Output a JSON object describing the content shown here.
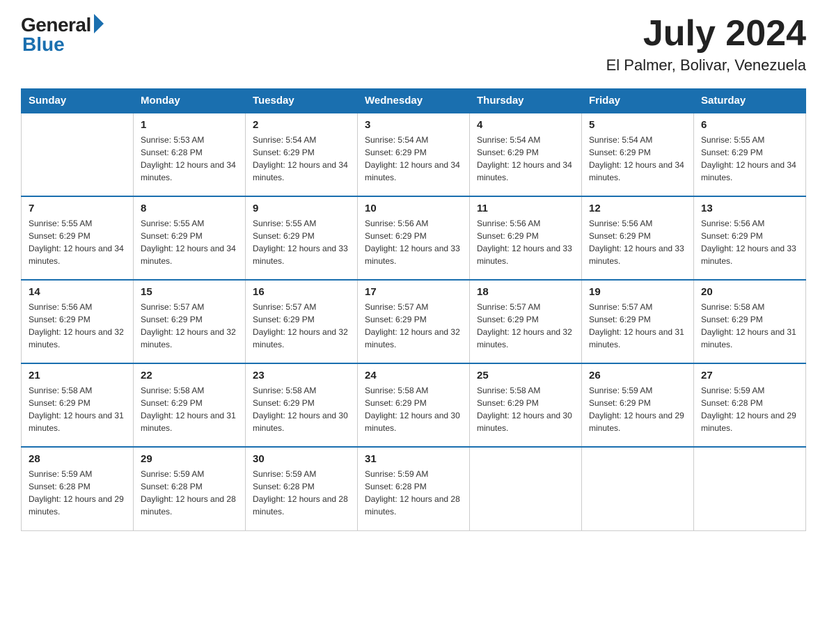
{
  "header": {
    "logo_general": "General",
    "logo_blue": "Blue",
    "month_title": "July 2024",
    "location": "El Palmer, Bolivar, Venezuela"
  },
  "days_of_week": [
    "Sunday",
    "Monday",
    "Tuesday",
    "Wednesday",
    "Thursday",
    "Friday",
    "Saturday"
  ],
  "weeks": [
    [
      {
        "day": "",
        "sunrise": "",
        "sunset": "",
        "daylight": ""
      },
      {
        "day": "1",
        "sunrise": "Sunrise: 5:53 AM",
        "sunset": "Sunset: 6:28 PM",
        "daylight": "Daylight: 12 hours and 34 minutes."
      },
      {
        "day": "2",
        "sunrise": "Sunrise: 5:54 AM",
        "sunset": "Sunset: 6:29 PM",
        "daylight": "Daylight: 12 hours and 34 minutes."
      },
      {
        "day": "3",
        "sunrise": "Sunrise: 5:54 AM",
        "sunset": "Sunset: 6:29 PM",
        "daylight": "Daylight: 12 hours and 34 minutes."
      },
      {
        "day": "4",
        "sunrise": "Sunrise: 5:54 AM",
        "sunset": "Sunset: 6:29 PM",
        "daylight": "Daylight: 12 hours and 34 minutes."
      },
      {
        "day": "5",
        "sunrise": "Sunrise: 5:54 AM",
        "sunset": "Sunset: 6:29 PM",
        "daylight": "Daylight: 12 hours and 34 minutes."
      },
      {
        "day": "6",
        "sunrise": "Sunrise: 5:55 AM",
        "sunset": "Sunset: 6:29 PM",
        "daylight": "Daylight: 12 hours and 34 minutes."
      }
    ],
    [
      {
        "day": "7",
        "sunrise": "Sunrise: 5:55 AM",
        "sunset": "Sunset: 6:29 PM",
        "daylight": "Daylight: 12 hours and 34 minutes."
      },
      {
        "day": "8",
        "sunrise": "Sunrise: 5:55 AM",
        "sunset": "Sunset: 6:29 PM",
        "daylight": "Daylight: 12 hours and 34 minutes."
      },
      {
        "day": "9",
        "sunrise": "Sunrise: 5:55 AM",
        "sunset": "Sunset: 6:29 PM",
        "daylight": "Daylight: 12 hours and 33 minutes."
      },
      {
        "day": "10",
        "sunrise": "Sunrise: 5:56 AM",
        "sunset": "Sunset: 6:29 PM",
        "daylight": "Daylight: 12 hours and 33 minutes."
      },
      {
        "day": "11",
        "sunrise": "Sunrise: 5:56 AM",
        "sunset": "Sunset: 6:29 PM",
        "daylight": "Daylight: 12 hours and 33 minutes."
      },
      {
        "day": "12",
        "sunrise": "Sunrise: 5:56 AM",
        "sunset": "Sunset: 6:29 PM",
        "daylight": "Daylight: 12 hours and 33 minutes."
      },
      {
        "day": "13",
        "sunrise": "Sunrise: 5:56 AM",
        "sunset": "Sunset: 6:29 PM",
        "daylight": "Daylight: 12 hours and 33 minutes."
      }
    ],
    [
      {
        "day": "14",
        "sunrise": "Sunrise: 5:56 AM",
        "sunset": "Sunset: 6:29 PM",
        "daylight": "Daylight: 12 hours and 32 minutes."
      },
      {
        "day": "15",
        "sunrise": "Sunrise: 5:57 AM",
        "sunset": "Sunset: 6:29 PM",
        "daylight": "Daylight: 12 hours and 32 minutes."
      },
      {
        "day": "16",
        "sunrise": "Sunrise: 5:57 AM",
        "sunset": "Sunset: 6:29 PM",
        "daylight": "Daylight: 12 hours and 32 minutes."
      },
      {
        "day": "17",
        "sunrise": "Sunrise: 5:57 AM",
        "sunset": "Sunset: 6:29 PM",
        "daylight": "Daylight: 12 hours and 32 minutes."
      },
      {
        "day": "18",
        "sunrise": "Sunrise: 5:57 AM",
        "sunset": "Sunset: 6:29 PM",
        "daylight": "Daylight: 12 hours and 32 minutes."
      },
      {
        "day": "19",
        "sunrise": "Sunrise: 5:57 AM",
        "sunset": "Sunset: 6:29 PM",
        "daylight": "Daylight: 12 hours and 31 minutes."
      },
      {
        "day": "20",
        "sunrise": "Sunrise: 5:58 AM",
        "sunset": "Sunset: 6:29 PM",
        "daylight": "Daylight: 12 hours and 31 minutes."
      }
    ],
    [
      {
        "day": "21",
        "sunrise": "Sunrise: 5:58 AM",
        "sunset": "Sunset: 6:29 PM",
        "daylight": "Daylight: 12 hours and 31 minutes."
      },
      {
        "day": "22",
        "sunrise": "Sunrise: 5:58 AM",
        "sunset": "Sunset: 6:29 PM",
        "daylight": "Daylight: 12 hours and 31 minutes."
      },
      {
        "day": "23",
        "sunrise": "Sunrise: 5:58 AM",
        "sunset": "Sunset: 6:29 PM",
        "daylight": "Daylight: 12 hours and 30 minutes."
      },
      {
        "day": "24",
        "sunrise": "Sunrise: 5:58 AM",
        "sunset": "Sunset: 6:29 PM",
        "daylight": "Daylight: 12 hours and 30 minutes."
      },
      {
        "day": "25",
        "sunrise": "Sunrise: 5:58 AM",
        "sunset": "Sunset: 6:29 PM",
        "daylight": "Daylight: 12 hours and 30 minutes."
      },
      {
        "day": "26",
        "sunrise": "Sunrise: 5:59 AM",
        "sunset": "Sunset: 6:29 PM",
        "daylight": "Daylight: 12 hours and 29 minutes."
      },
      {
        "day": "27",
        "sunrise": "Sunrise: 5:59 AM",
        "sunset": "Sunset: 6:28 PM",
        "daylight": "Daylight: 12 hours and 29 minutes."
      }
    ],
    [
      {
        "day": "28",
        "sunrise": "Sunrise: 5:59 AM",
        "sunset": "Sunset: 6:28 PM",
        "daylight": "Daylight: 12 hours and 29 minutes."
      },
      {
        "day": "29",
        "sunrise": "Sunrise: 5:59 AM",
        "sunset": "Sunset: 6:28 PM",
        "daylight": "Daylight: 12 hours and 28 minutes."
      },
      {
        "day": "30",
        "sunrise": "Sunrise: 5:59 AM",
        "sunset": "Sunset: 6:28 PM",
        "daylight": "Daylight: 12 hours and 28 minutes."
      },
      {
        "day": "31",
        "sunrise": "Sunrise: 5:59 AM",
        "sunset": "Sunset: 6:28 PM",
        "daylight": "Daylight: 12 hours and 28 minutes."
      },
      {
        "day": "",
        "sunrise": "",
        "sunset": "",
        "daylight": ""
      },
      {
        "day": "",
        "sunrise": "",
        "sunset": "",
        "daylight": ""
      },
      {
        "day": "",
        "sunrise": "",
        "sunset": "",
        "daylight": ""
      }
    ]
  ]
}
